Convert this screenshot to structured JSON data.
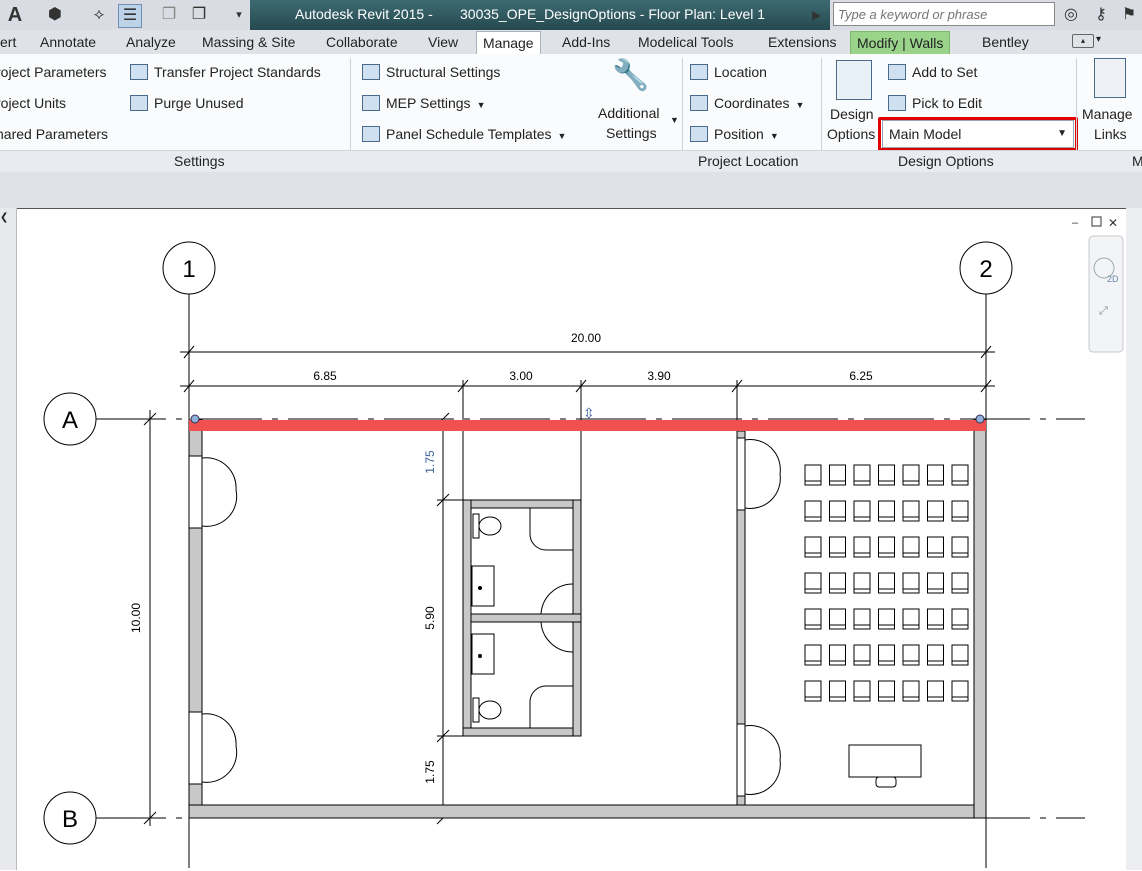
{
  "titlebar": {
    "app_title": "Autodesk Revit 2015 -",
    "doc_title": "30035_OPE_DesignOptions - Floor Plan: Level 1",
    "search_placeholder": "Type a keyword or phrase"
  },
  "tabs": [
    {
      "label": "ert"
    },
    {
      "label": "Annotate"
    },
    {
      "label": "Analyze"
    },
    {
      "label": "Massing & Site"
    },
    {
      "label": "Collaborate"
    },
    {
      "label": "View"
    },
    {
      "label": "Manage"
    },
    {
      "label": "Add-Ins"
    },
    {
      "label": "Modelical Tools"
    },
    {
      "label": "Extensions"
    },
    {
      "label": "Modify | Walls"
    },
    {
      "label": "Bentley"
    }
  ],
  "ribbon": {
    "settings": {
      "items": [
        "roject  Parameters",
        "roject  Units",
        "hared  Parameters"
      ],
      "items2": [
        "Transfer  Project Standards",
        "Purge  Unused"
      ],
      "items3": [
        "Structural  Settings",
        "MEP  Settings",
        "Panel Schedule  Templates"
      ],
      "additional_line1": "Additional",
      "additional_line2": "Settings",
      "title": "Settings"
    },
    "project_location": {
      "items": [
        "Location",
        "Coordinates",
        "Position"
      ],
      "title": "Project Location"
    },
    "design_options": {
      "design_line1": "Design",
      "design_line2": "Options",
      "add_to_set": "Add to Set",
      "pick_to_edit": "Pick to Edit",
      "selected_option": "Main Model",
      "title": "Design Options"
    },
    "manage_links": {
      "line1": "Manage",
      "line2": "Links",
      "title_partial": "M"
    }
  },
  "floorplan": {
    "grid_labels": {
      "g1": "1",
      "g2": "2",
      "gA": "A",
      "gB": "B"
    },
    "dimensions": {
      "overall": "20.00",
      "seg1": "6.85",
      "seg2": "3.00",
      "seg3": "3.90",
      "seg4": "6.25",
      "height": "10.00",
      "v1": "1.75",
      "v2": "5.90",
      "v3": "1.75"
    },
    "view_cube_label": "2D",
    "selected_wall_color": "#f05050"
  },
  "colors": {
    "accent_red": "#e00000",
    "title_bar": "#2f5a60",
    "context_tab": "#9ad48a"
  }
}
